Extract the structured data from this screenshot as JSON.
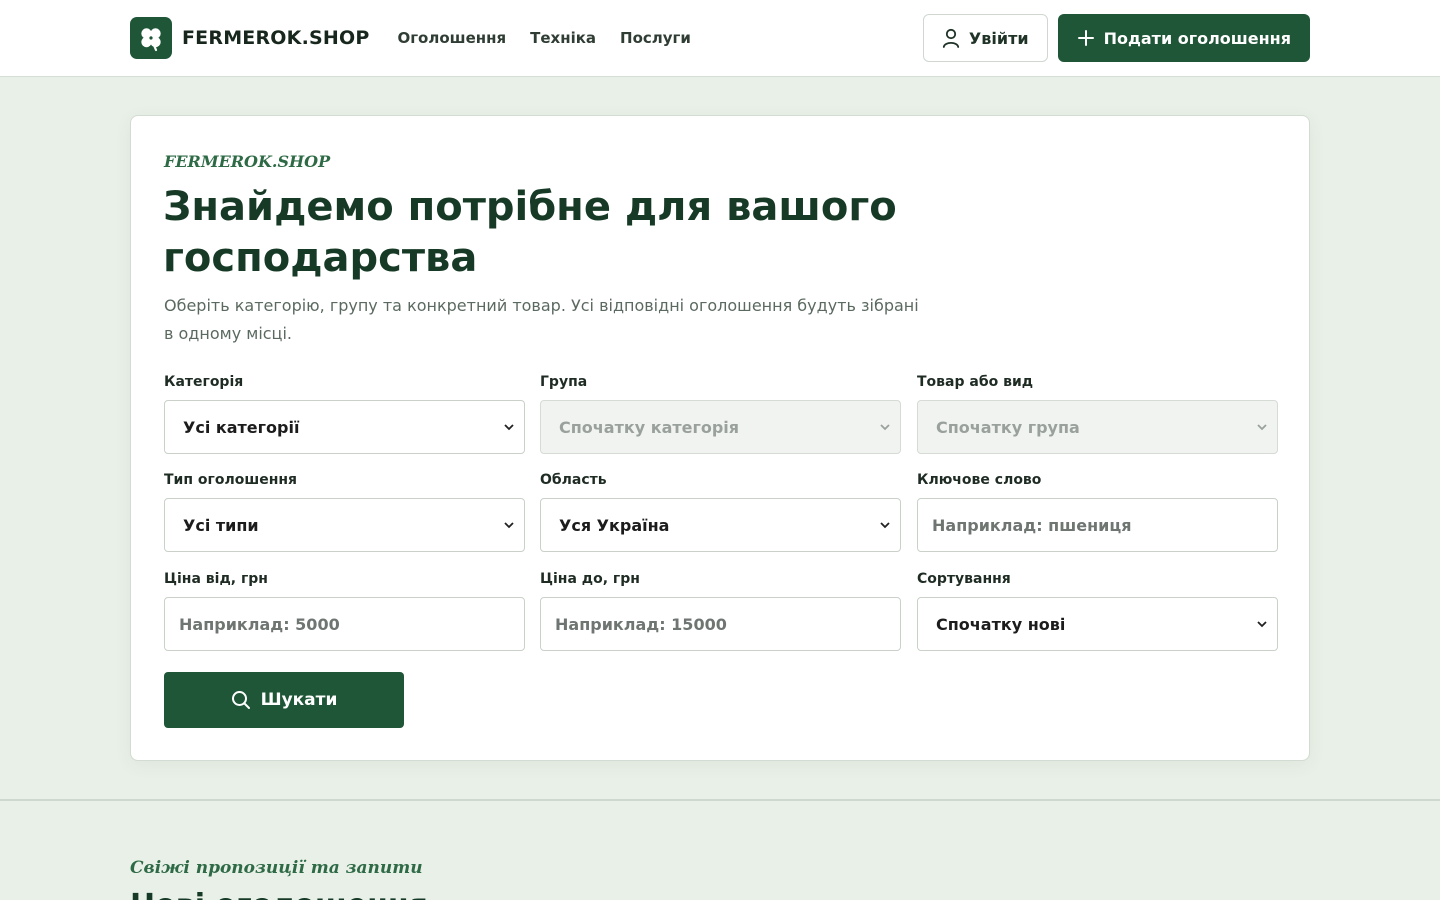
{
  "header": {
    "brand": "FERMEROK.SHOP",
    "nav": [
      "Оголошення",
      "Техніка",
      "Послуги"
    ],
    "login_label": "Увійти",
    "post_label": "Подати оголошення"
  },
  "hero": {
    "eyebrow": "FERMEROK.SHOP",
    "title": "Знайдемо потрібне для вашого господарства",
    "subtitle": "Оберіть категорію, групу та конкретний товар. Усі відповідні оголошення будуть зібрані в одному місці."
  },
  "filters": {
    "category": {
      "label": "Категорія",
      "value": "Усі категорії"
    },
    "group": {
      "label": "Група",
      "value": "Спочатку категорія"
    },
    "product": {
      "label": "Товар або вид",
      "value": "Спочатку група"
    },
    "type": {
      "label": "Тип оголошення",
      "value": "Усі типи"
    },
    "region": {
      "label": "Область",
      "value": "Уся Україна"
    },
    "keyword": {
      "label": "Ключове слово",
      "placeholder": "Наприклад: пшениця"
    },
    "price_from": {
      "label": "Ціна від, грн",
      "placeholder": "Наприклад: 5000"
    },
    "price_to": {
      "label": "Ціна до, грн",
      "placeholder": "Наприклад: 15000"
    },
    "sort": {
      "label": "Сортування",
      "value": "Спочатку нові"
    },
    "search_label": "Шукати"
  },
  "section": {
    "eyebrow": "Свіжі пропозиції та запити",
    "title": "Нові оголошення"
  },
  "colors": {
    "primary": "#1f5637",
    "background": "#e9f0e8",
    "accent_text": "#2e6a45"
  }
}
